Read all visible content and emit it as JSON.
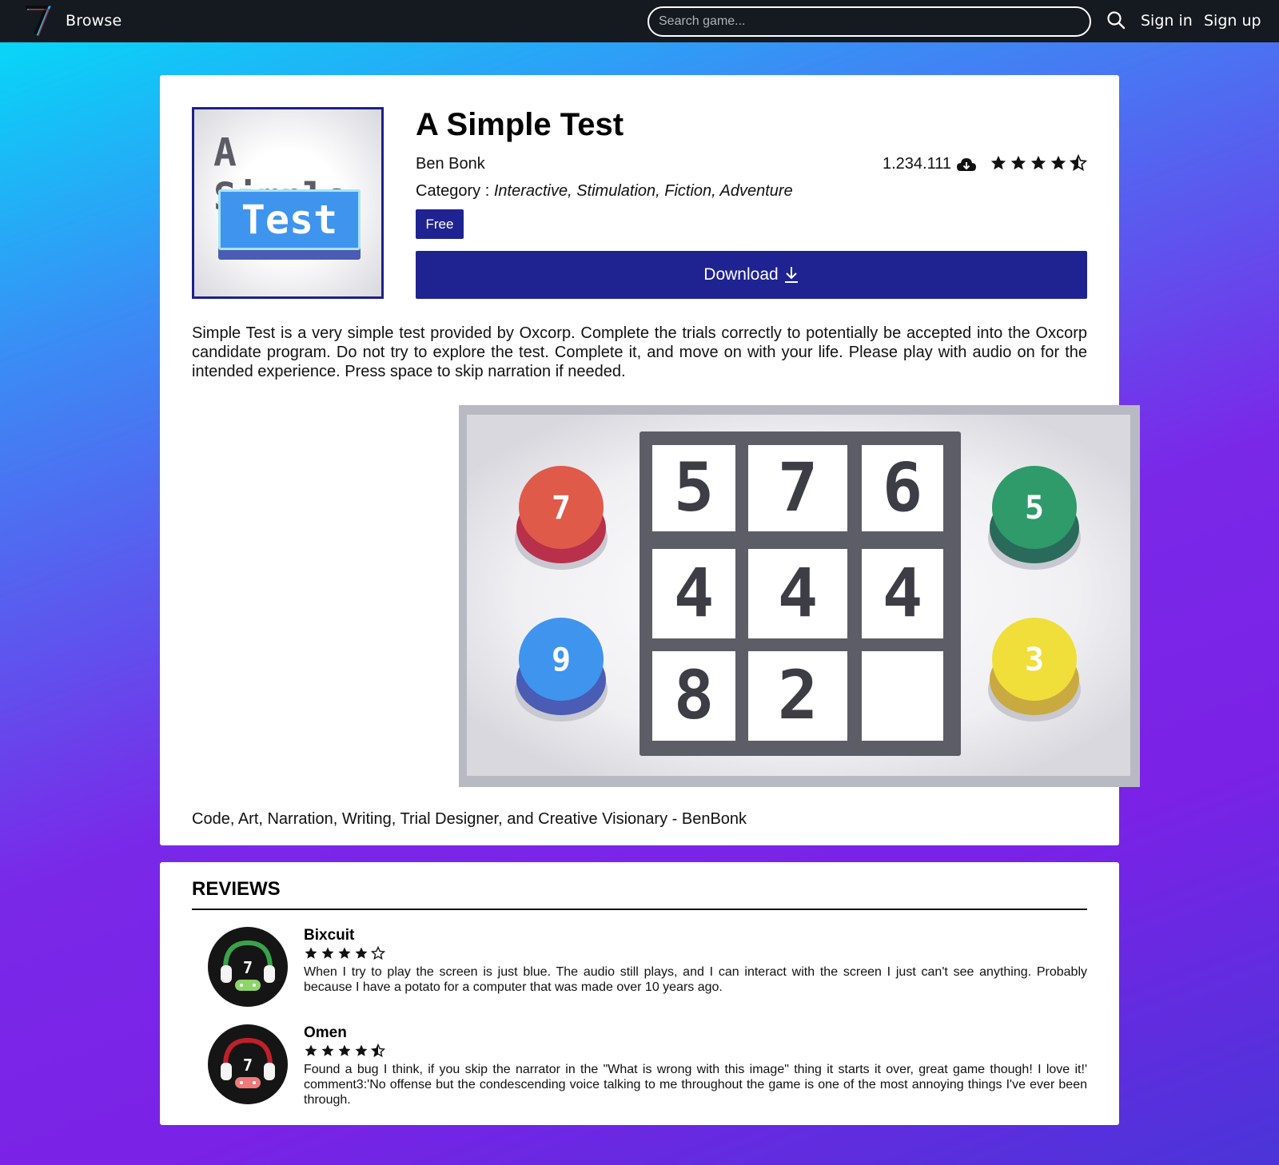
{
  "topbar": {
    "browse": "Browse",
    "search_placeholder": "Search game...",
    "sign_in": "Sign in",
    "sign_up": "Sign up",
    "logo_icon": "7-logo-icon",
    "search_icon": "search-icon"
  },
  "game": {
    "cover_line1": "A Simple",
    "cover_line2": "Test",
    "title": "A Simple Test",
    "author": "Ben Bonk",
    "downloads": "1.234.111",
    "rating": 4.5,
    "category_label": "Category : ",
    "categories": "Interactive, Stimulation, Fiction, Adventure",
    "price": "Free",
    "download_label": "Download",
    "description": "Simple Test is a very simple test provided by Oxcorp. Complete the trials correctly to potentially be accepted into the Oxcorp candidate program. Do not try to explore the test. Complete it, and move on with your life. Please play with audio on for the intended experience. Press space to skip narration if needed.",
    "credits": "Code, Art, Narration, Writing, Trial Designer, and Creative Visionary - BenBonk"
  },
  "screenshot": {
    "grid": [
      "5",
      "7",
      "6",
      "4",
      "4",
      "4",
      "8",
      "2",
      ""
    ],
    "buttons": [
      {
        "label": "7",
        "color": "#e05a4a"
      },
      {
        "label": "9",
        "color": "#3f94ee"
      },
      {
        "label": "5",
        "color": "#2f9a6a"
      },
      {
        "label": "3",
        "color": "#f0de3a"
      }
    ]
  },
  "reviews": {
    "title": "REVIEWS",
    "items": [
      {
        "user": "Bixcuit",
        "rating": 4,
        "text": "When I try to play the screen is just blue. The audio still plays, and I can interact with the screen I just can't see anything. Probably because I have a potato for a computer that was made over 10 years ago.",
        "accent": "#3aa34a"
      },
      {
        "user": "Omen",
        "rating": 4.5,
        "text": "Found a bug I think, if you skip the narrator in the \"What is wrong with this image\" thing it starts it over, great game though! I love it!' comment3:'No offense but the condescending voice talking to me throughout the game is one of the most annoying things I've ever been through.",
        "accent": "#c0202a"
      }
    ]
  },
  "colors": {
    "brand": "#1f2391",
    "topbar": "#151a20"
  }
}
